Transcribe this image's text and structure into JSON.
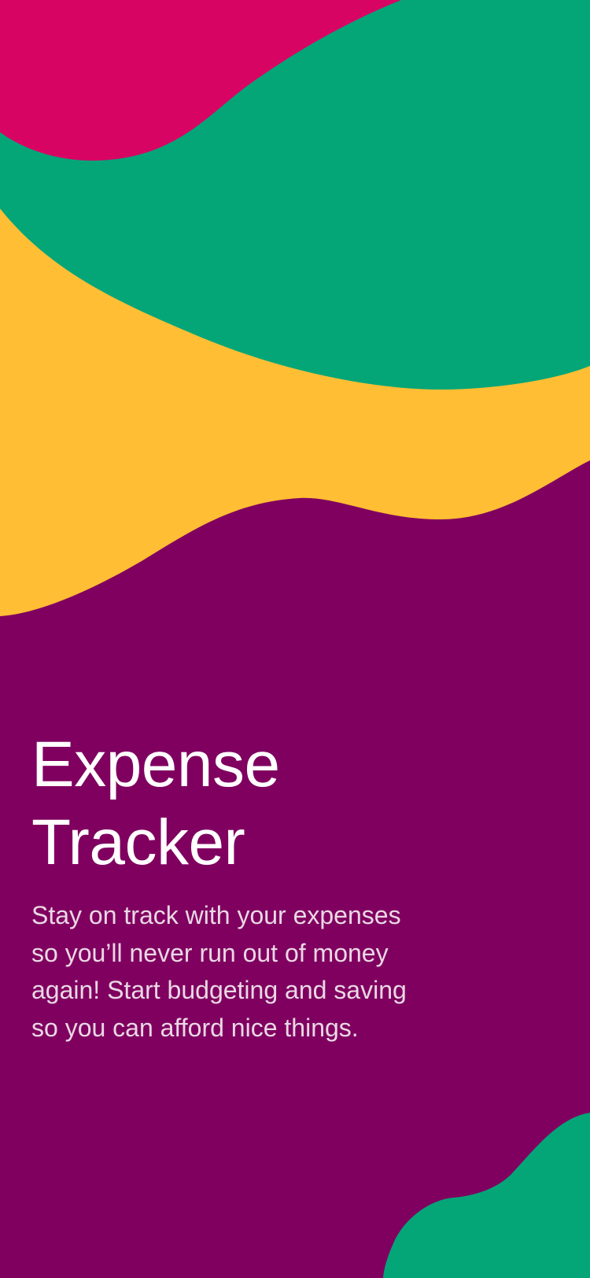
{
  "onboarding": {
    "title_lines": [
      "Expense",
      "Tracker"
    ],
    "description_lines": [
      "Stay on track with your expenses",
      "so you’ll never run out of money",
      "again! Start budgeting and saving",
      "so you can afford nice things."
    ]
  },
  "colors": {
    "background": "#800060",
    "magenta": "#D80464",
    "green": "#04A678",
    "yellow": "#FFBE34",
    "text_primary": "#FFFFFF",
    "text_secondary": "#EAD8E4"
  }
}
